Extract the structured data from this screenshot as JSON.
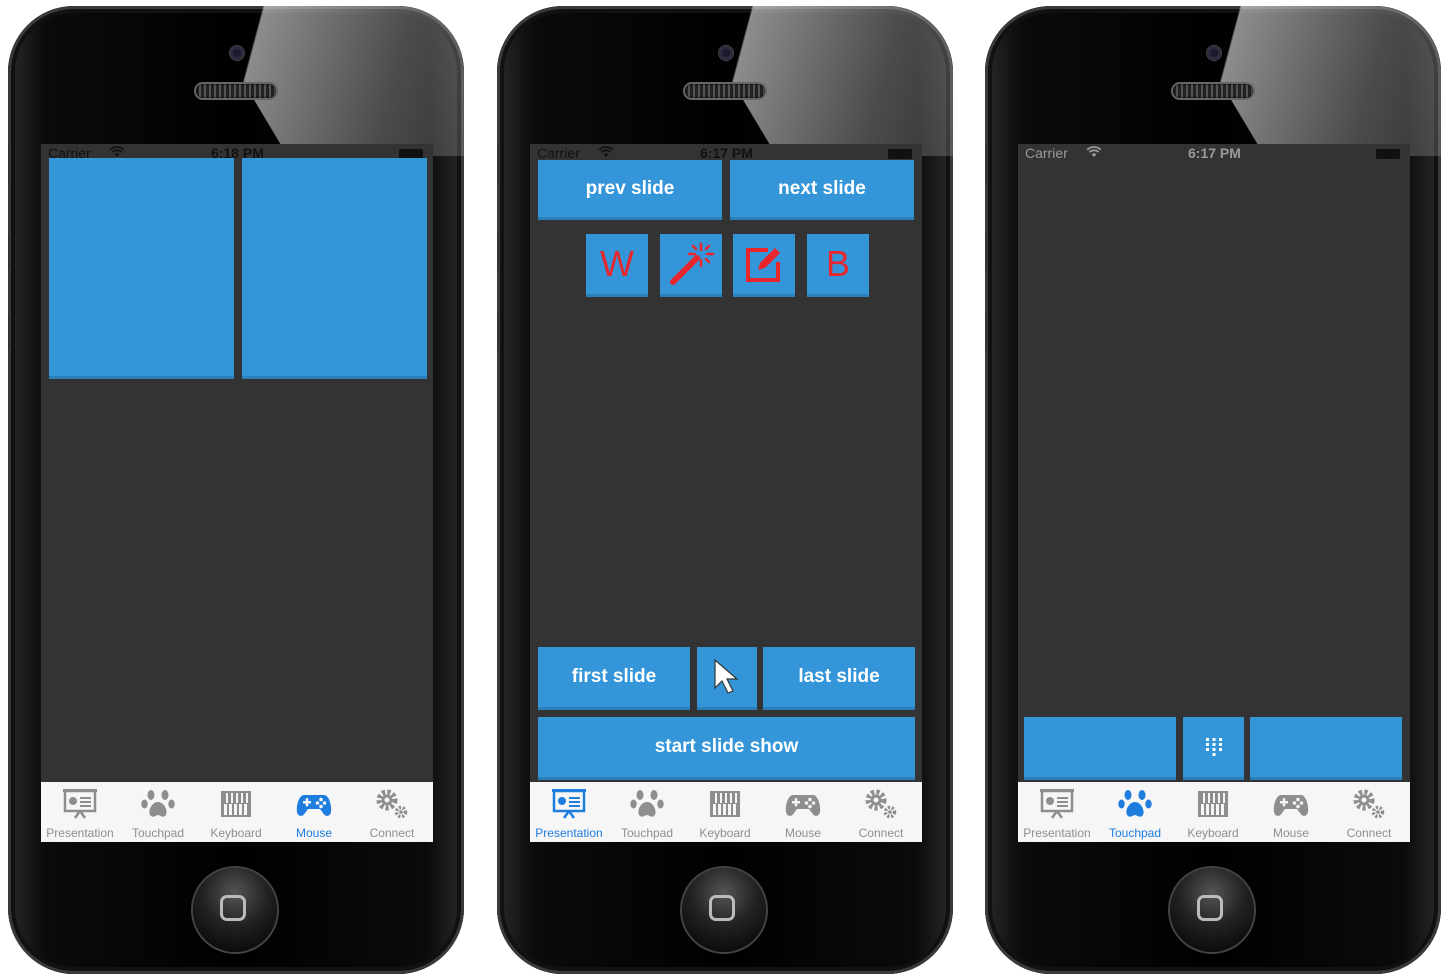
{
  "phones": [
    {
      "status": {
        "carrier": "Carrier",
        "time": "6:18 PM"
      },
      "active_tab": "Mouse"
    },
    {
      "status": {
        "carrier": "Carrier",
        "time": "6:17 PM"
      },
      "active_tab": "Presentation",
      "buttons": {
        "prev": "prev slide",
        "next": "next slide",
        "w": "W",
        "b": "B",
        "first": "first slide",
        "last": "last slide",
        "start": "start slide show"
      }
    },
    {
      "status": {
        "carrier": "Carrier",
        "time": "6:17 PM"
      },
      "active_tab": "Touchpad"
    }
  ],
  "tabs": [
    "Presentation",
    "Touchpad",
    "Keyboard",
    "Mouse",
    "Connect"
  ],
  "colors": {
    "accent": "#3496d9",
    "tab_active": "#1f7de0",
    "tab_inactive": "#8e8e8e",
    "screen_bg": "#333333",
    "icon_red": "#e8262c"
  },
  "icons": [
    "wifi-icon",
    "magic-wand-icon",
    "edit-icon",
    "cursor-icon",
    "keypad-icon",
    "presentation-icon",
    "paw-icon",
    "keyboard-icon",
    "gamepad-icon",
    "gears-icon"
  ]
}
